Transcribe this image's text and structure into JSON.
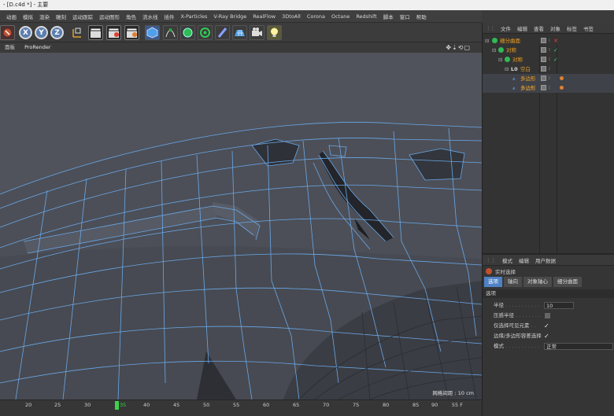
{
  "window": {
    "title": "- [D.c4d *] - 主要"
  },
  "menu": [
    {
      "label": "动画",
      "highlight": false
    },
    {
      "label": "模拟",
      "highlight": false
    },
    {
      "label": "渲染",
      "highlight": false
    },
    {
      "label": "雕刻",
      "highlight": false
    },
    {
      "label": "运动跟踪",
      "highlight": false
    },
    {
      "label": "运动图形",
      "highlight": false
    },
    {
      "label": "角色",
      "highlight": false
    },
    {
      "label": "流水线",
      "highlight": false
    },
    {
      "label": "插件",
      "highlight": false
    },
    {
      "label": "X-Particles",
      "highlight": false
    },
    {
      "label": "V-Ray Bridge",
      "highlight": false
    },
    {
      "label": "RealFlow",
      "highlight": false
    },
    {
      "label": "3DtoAll",
      "highlight": false
    },
    {
      "label": "Corona",
      "highlight": false
    },
    {
      "label": "Octane",
      "highlight": false
    },
    {
      "label": "Redshift",
      "highlight": false
    },
    {
      "label": "脚本",
      "highlight": false
    },
    {
      "label": "窗口",
      "highlight": false
    },
    {
      "label": "帮助",
      "highlight": false
    }
  ],
  "toolbar": {
    "axis_x": "X",
    "axis_y": "Y",
    "axis_z": "Z"
  },
  "viewport": {
    "menu_label": "面板",
    "renderer_label": "ProRender",
    "nav_icons": "✥⇣⟲▢",
    "grid_info": "网格间距 : 10 cm"
  },
  "timeline": {
    "ticks": [
      "20",
      "25",
      "30",
      "35",
      "40",
      "45",
      "50",
      "55",
      "60",
      "65",
      "70",
      "75",
      "80",
      "85",
      "90",
      "95"
    ],
    "current_frame": "35",
    "end_label": "55 F"
  },
  "object_manager": {
    "menu": [
      "文件",
      "编辑",
      "查看",
      "对象",
      "标签",
      "书签"
    ],
    "objects": [
      {
        "name": "细分曲面",
        "state": "x"
      },
      {
        "name": "对称",
        "state": "check"
      },
      {
        "name": "对称",
        "state": "check"
      },
      {
        "name": "空白",
        "state": "none"
      },
      {
        "name": "多边形",
        "state": "none"
      },
      {
        "name": "多边形",
        "state": "none"
      }
    ]
  },
  "attributes": {
    "menu": [
      "模式",
      "编辑",
      "用户数据"
    ],
    "title": "实时选择",
    "tabs": [
      "选项",
      "轴向",
      "对象轴心",
      "细分曲面"
    ],
    "section": "选项",
    "rows": {
      "radius_label": "半径",
      "radius_value": "10",
      "pressure_label": "压感半径",
      "visible_only_label": "仅选择可见元素",
      "edge_poly_label": "边缘/多边形容差选择",
      "mode_label": "模式",
      "mode_value": "正常"
    }
  },
  "colors": {
    "accent": "#4f82c4",
    "orange": "#f0a020",
    "mesh_wire": "#6aa8e8",
    "mesh_fill": "#4c4f57"
  }
}
